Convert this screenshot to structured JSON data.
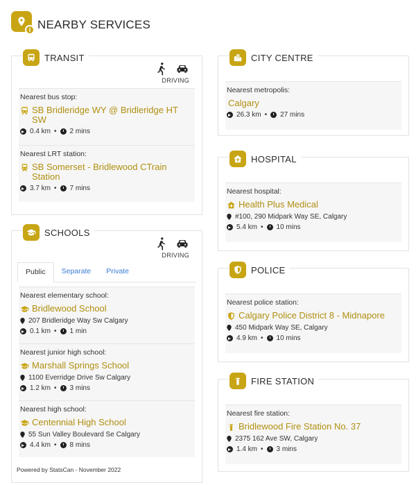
{
  "header": {
    "title": "NEARBY SERVICES"
  },
  "transit": {
    "title": "TRANSIT",
    "mode_label": "DRIVING",
    "entries": [
      {
        "label": "Nearest bus stop:",
        "name": "SB Bridleridge WY @ Bridleridge HT SW",
        "distance": "0.4 km",
        "time": "2 mins"
      },
      {
        "label": "Nearest LRT station:",
        "name": "SB Somerset - Bridlewood CTrain Station",
        "distance": "3.7 km",
        "time": "7 mins"
      }
    ]
  },
  "schools": {
    "title": "SCHOOLS",
    "mode_label": "DRIVING",
    "tabs": [
      "Public",
      "Separate",
      "Private"
    ],
    "active_tab": "Public",
    "entries": [
      {
        "label": "Nearest elementary school:",
        "name": "Bridlewood School",
        "address": "207 Bridleridge Way Sw Calgary",
        "distance": "0.1 km",
        "time": "1 min"
      },
      {
        "label": "Nearest junior high school:",
        "name": "Marshall Springs School",
        "address": "1100 Everridge Drive Sw Calgary",
        "distance": "1.2 km",
        "time": "3 mins"
      },
      {
        "label": "Nearest high school:",
        "name": "Centennial High School",
        "address": "55 Sun Valley Boulevard Se Calgary",
        "distance": "4.4 km",
        "time": "8 mins"
      }
    ]
  },
  "city_centre": {
    "title": "CITY CENTRE",
    "entry": {
      "label": "Nearest metropolis:",
      "name": "Calgary",
      "distance": "26.3 km",
      "time": "27 mins"
    }
  },
  "hospital": {
    "title": "HOSPITAL",
    "entry": {
      "label": "Nearest hospital:",
      "name": "Health Plus Medical",
      "address": "#100, 290 Midpark Way SE, Calgary",
      "distance": "5.4 km",
      "time": "10 mins"
    }
  },
  "police": {
    "title": "POLICE",
    "entry": {
      "label": "Nearest police station:",
      "name": "Calgary Police District 8 - Midnapore",
      "address": "450 Midpark Way SE, Calgary",
      "distance": "4.9 km",
      "time": "10 mins"
    }
  },
  "fire": {
    "title": "FIRE STATION",
    "entry": {
      "label": "Nearest fire station:",
      "name": "Bridlewood Fire Station No. 37",
      "address": "2375 162 Ave SW, Calgary",
      "distance": "1.4 km",
      "time": "3 mins"
    }
  },
  "footer": {
    "powered": "Powered by StatsCan - November 2022"
  },
  "colors": {
    "accent": "#c8a514",
    "accent_text": "#b08f10",
    "link": "#3a7bd5"
  }
}
